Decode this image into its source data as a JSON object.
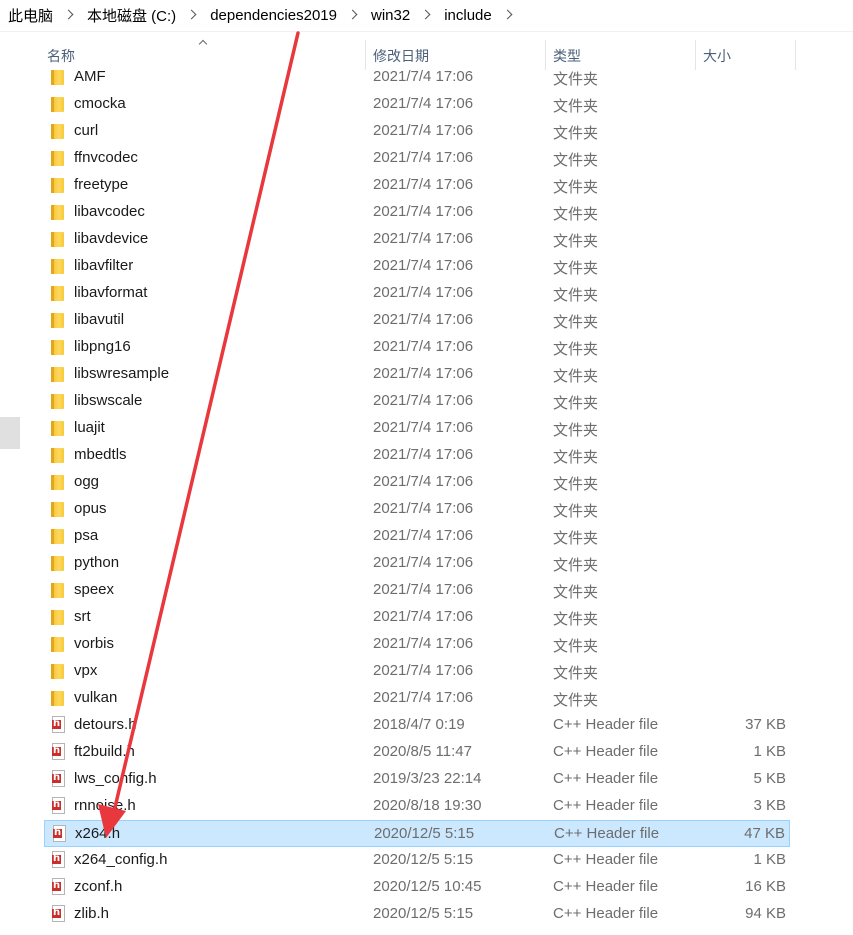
{
  "breadcrumb": [
    "此电脑",
    "本地磁盘 (C:)",
    "dependencies2019",
    "win32",
    "include"
  ],
  "columns": {
    "name": "名称",
    "date": "修改日期",
    "type": "类型",
    "size": "大小"
  },
  "rows": [
    {
      "name": "AMF",
      "date": "2021/7/4 17:06",
      "type": "文件夹",
      "size": "",
      "kind": "folder"
    },
    {
      "name": "cmocka",
      "date": "2021/7/4 17:06",
      "type": "文件夹",
      "size": "",
      "kind": "folder"
    },
    {
      "name": "curl",
      "date": "2021/7/4 17:06",
      "type": "文件夹",
      "size": "",
      "kind": "folder"
    },
    {
      "name": "ffnvcodec",
      "date": "2021/7/4 17:06",
      "type": "文件夹",
      "size": "",
      "kind": "folder"
    },
    {
      "name": "freetype",
      "date": "2021/7/4 17:06",
      "type": "文件夹",
      "size": "",
      "kind": "folder"
    },
    {
      "name": "libavcodec",
      "date": "2021/7/4 17:06",
      "type": "文件夹",
      "size": "",
      "kind": "folder"
    },
    {
      "name": "libavdevice",
      "date": "2021/7/4 17:06",
      "type": "文件夹",
      "size": "",
      "kind": "folder"
    },
    {
      "name": "libavfilter",
      "date": "2021/7/4 17:06",
      "type": "文件夹",
      "size": "",
      "kind": "folder"
    },
    {
      "name": "libavformat",
      "date": "2021/7/4 17:06",
      "type": "文件夹",
      "size": "",
      "kind": "folder"
    },
    {
      "name": "libavutil",
      "date": "2021/7/4 17:06",
      "type": "文件夹",
      "size": "",
      "kind": "folder"
    },
    {
      "name": "libpng16",
      "date": "2021/7/4 17:06",
      "type": "文件夹",
      "size": "",
      "kind": "folder"
    },
    {
      "name": "libswresample",
      "date": "2021/7/4 17:06",
      "type": "文件夹",
      "size": "",
      "kind": "folder"
    },
    {
      "name": "libswscale",
      "date": "2021/7/4 17:06",
      "type": "文件夹",
      "size": "",
      "kind": "folder"
    },
    {
      "name": "luajit",
      "date": "2021/7/4 17:06",
      "type": "文件夹",
      "size": "",
      "kind": "folder"
    },
    {
      "name": "mbedtls",
      "date": "2021/7/4 17:06",
      "type": "文件夹",
      "size": "",
      "kind": "folder"
    },
    {
      "name": "ogg",
      "date": "2021/7/4 17:06",
      "type": "文件夹",
      "size": "",
      "kind": "folder"
    },
    {
      "name": "opus",
      "date": "2021/7/4 17:06",
      "type": "文件夹",
      "size": "",
      "kind": "folder"
    },
    {
      "name": "psa",
      "date": "2021/7/4 17:06",
      "type": "文件夹",
      "size": "",
      "kind": "folder"
    },
    {
      "name": "python",
      "date": "2021/7/4 17:06",
      "type": "文件夹",
      "size": "",
      "kind": "folder"
    },
    {
      "name": "speex",
      "date": "2021/7/4 17:06",
      "type": "文件夹",
      "size": "",
      "kind": "folder"
    },
    {
      "name": "srt",
      "date": "2021/7/4 17:06",
      "type": "文件夹",
      "size": "",
      "kind": "folder"
    },
    {
      "name": "vorbis",
      "date": "2021/7/4 17:06",
      "type": "文件夹",
      "size": "",
      "kind": "folder"
    },
    {
      "name": "vpx",
      "date": "2021/7/4 17:06",
      "type": "文件夹",
      "size": "",
      "kind": "folder"
    },
    {
      "name": "vulkan",
      "date": "2021/7/4 17:06",
      "type": "文件夹",
      "size": "",
      "kind": "folder"
    },
    {
      "name": "detours.h",
      "date": "2018/4/7 0:19",
      "type": "C++ Header file",
      "size": "37 KB",
      "kind": "file"
    },
    {
      "name": "ft2build.h",
      "date": "2020/8/5 11:47",
      "type": "C++ Header file",
      "size": "1 KB",
      "kind": "file"
    },
    {
      "name": "lws_config.h",
      "date": "2019/3/23 22:14",
      "type": "C++ Header file",
      "size": "5 KB",
      "kind": "file"
    },
    {
      "name": "rnnoise.h",
      "date": "2020/8/18 19:30",
      "type": "C++ Header file",
      "size": "3 KB",
      "kind": "file"
    },
    {
      "name": "x264.h",
      "date": "2020/12/5 5:15",
      "type": "C++ Header file",
      "size": "47 KB",
      "kind": "file",
      "selected": true
    },
    {
      "name": "x264_config.h",
      "date": "2020/12/5 5:15",
      "type": "C++ Header file",
      "size": "1 KB",
      "kind": "file"
    },
    {
      "name": "zconf.h",
      "date": "2020/12/5 10:45",
      "type": "C++ Header file",
      "size": "16 KB",
      "kind": "file"
    },
    {
      "name": "zlib.h",
      "date": "2020/12/5 5:15",
      "type": "C++ Header file",
      "size": "94 KB",
      "kind": "file"
    }
  ],
  "colors": {
    "selected_bg": "#cce8ff",
    "selected_border": "#99d1ff",
    "annotation_arrow": "#e8383d",
    "folder": "#ffd85c",
    "header_icon": "#c9302c"
  }
}
